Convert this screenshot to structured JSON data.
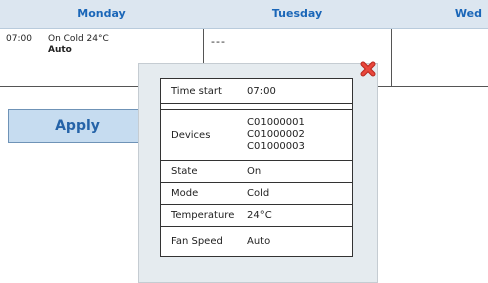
{
  "days": [
    "Monday",
    "Tuesday",
    "Wed"
  ],
  "monday_entry": {
    "time": "07:00",
    "summary": "On Cold 24°C",
    "fan": "Auto"
  },
  "tuesday_entry": "---",
  "apply_label": "Apply",
  "details": {
    "time_label": "Time start",
    "time_value": "07:00",
    "devices_label": "Devices",
    "devices": [
      "C01000001",
      "C01000002",
      "C01000003"
    ],
    "state_label": "State",
    "state_value": "On",
    "mode_label": "Mode",
    "mode_value": "Cold",
    "temp_label": "Temperature",
    "temp_value": "24°C",
    "fan_label": "Fan Speed",
    "fan_value": "Auto"
  },
  "colors": {
    "header_bg": "#dce6f0",
    "header_text": "#1a66b8",
    "button_bg": "#c6dcf0",
    "close": "#d9342b"
  },
  "icons": {
    "close": "close-x-icon"
  }
}
